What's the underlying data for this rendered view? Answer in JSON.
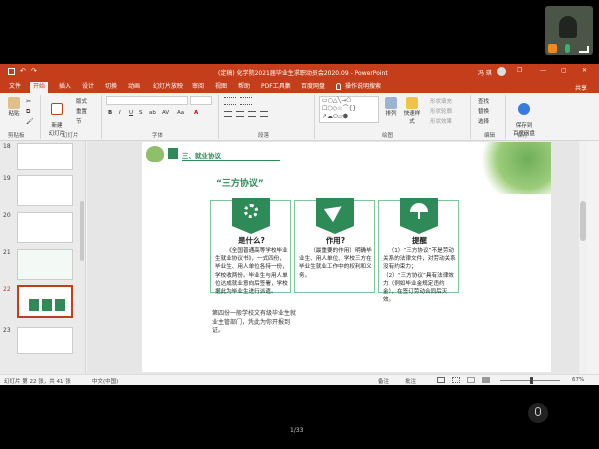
{
  "window": {
    "title": "(定稿) 化学院2021届毕业生求职动员会2020.09  -  PowerPoint",
    "user": "冯 琪"
  },
  "quick_access": {
    "save": "保存",
    "undo": "撤销",
    "redo": "重做"
  },
  "window_controls": {
    "restore": "❐",
    "minimize": "—",
    "maximize": "▢",
    "close": "✕"
  },
  "tabs": [
    "文件",
    "开始",
    "插入",
    "设计",
    "切换",
    "动画",
    "幻灯片放映",
    "审阅",
    "视图",
    "帮助",
    "PDF工具集",
    "百度网盘",
    "操作说明搜索"
  ],
  "ribbon": {
    "clipboard": {
      "label": "剪贴板",
      "paste": "粘贴"
    },
    "slides": {
      "label": "幻灯片",
      "new_slide": "新建\n幻灯片",
      "layout": "版式",
      "reset": "重置",
      "section": "节"
    },
    "font": {
      "label": "字体",
      "buttons": [
        "B",
        "I",
        "U",
        "S",
        "ab",
        "AV",
        "Aa",
        "A"
      ]
    },
    "paragraph": {
      "label": "段落"
    },
    "drawing": {
      "label": "绘图",
      "arrange": "排列",
      "quick_styles": "快速样式",
      "fill": "形状填充",
      "outline": "形状轮廓",
      "effects": "形状效果"
    },
    "editing": {
      "label": "编辑",
      "find": "查找",
      "replace": "替换",
      "select": "选择"
    },
    "save": {
      "label": "保存",
      "save_to_baidu": "保存到\n百度网盘"
    },
    "share": "共享"
  },
  "thumbnails": [
    {
      "num": "18"
    },
    {
      "num": "19"
    },
    {
      "num": "20"
    },
    {
      "num": "21"
    },
    {
      "num": "22"
    },
    {
      "num": "23"
    }
  ],
  "slide": {
    "section_title": "三、就业协议",
    "heading": "“三方协议”",
    "cards": [
      {
        "title": "是什么?",
        "body": "《全国普通高等学校毕业生就业协议书》，一式四份，毕业生、用人单位各持一份，学校收两份。毕业生与用人单位达成就业意向后签署，学校据此为毕业生进行派遣。"
      },
      {
        "title": "作用?",
        "body": "（最重要的作用）明确毕业生、用人单位、学校三方在毕业生就业工作中的权利和义务。"
      },
      {
        "title": "提醒",
        "body": "（1）“三方协议”不是劳动关系的法律文件，对劳动关系没有约束力；\n（2）“三方协议”具有法律效力（例如毕业金规定违约金），在签订劳动合同后灭效。"
      }
    ],
    "footnote": "第四份一般学校文有级毕业生就业主管部门，凭此为你开报到证。"
  },
  "status": {
    "slide_info": "幻灯片 第 22 张，共 41 张",
    "language": "中文(中国)",
    "notes": "备注",
    "comments": "批注",
    "zoom": "67%"
  },
  "page_indicator": "1/33",
  "colors": {
    "accent": "#c43e1c",
    "green": "#2e8b57",
    "card_border": "#7dc69a"
  }
}
